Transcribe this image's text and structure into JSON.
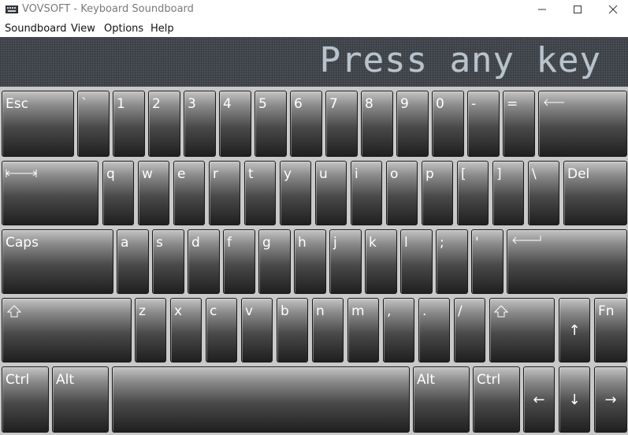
{
  "window": {
    "title": "VOVSOFT - Keyboard Soundboard"
  },
  "menu": {
    "items": [
      "Soundboard",
      "View",
      "Options",
      "Help"
    ]
  },
  "display": {
    "text": "Press any key"
  },
  "keys": {
    "esc": "Esc",
    "backtick": "`",
    "k1": "1",
    "k2": "2",
    "k3": "3",
    "k4": "4",
    "k5": "5",
    "k6": "6",
    "k7": "7",
    "k8": "8",
    "k9": "9",
    "k0": "0",
    "minus": "-",
    "equals": "=",
    "q": "q",
    "w": "w",
    "e": "e",
    "r": "r",
    "t": "t",
    "y": "y",
    "u": "u",
    "i": "i",
    "o": "o",
    "p": "p",
    "lbracket": "[",
    "rbracket": "]",
    "backslash": "\\",
    "del": "Del",
    "caps": "Caps",
    "a": "a",
    "s": "s",
    "d": "d",
    "f": "f",
    "g": "g",
    "h": "h",
    "j": "j",
    "k": "k",
    "l": "l",
    "semicolon": ";",
    "quote": "'",
    "z": "z",
    "x": "x",
    "c": "c",
    "v": "v",
    "b": "b",
    "n": "n",
    "m": "m",
    "comma": ",",
    "period": ".",
    "slash": "/",
    "fn": "Fn",
    "ctrl_left": "Ctrl",
    "alt_left": "Alt",
    "alt_right": "Alt",
    "ctrl_right": "Ctrl",
    "arrow_up": "↑",
    "arrow_left": "←",
    "arrow_down": "↓",
    "arrow_right": "→"
  }
}
